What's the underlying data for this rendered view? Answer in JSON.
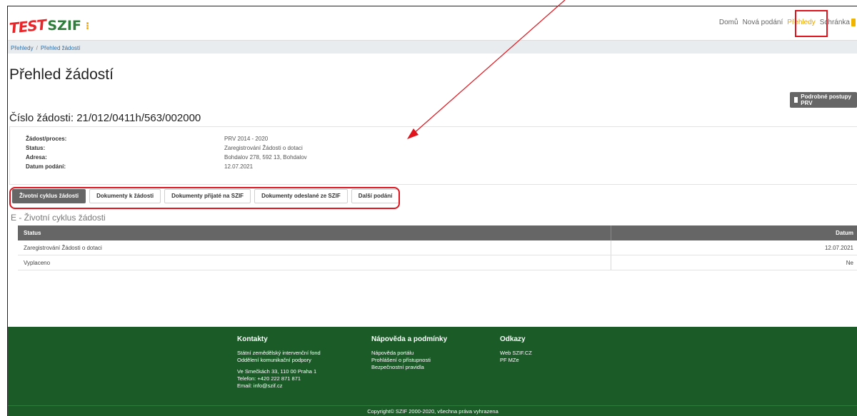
{
  "logo": {
    "test": "TEST",
    "szif": "SZIF"
  },
  "nav": {
    "items": [
      "Domů",
      "Nová podání",
      "Přehledy",
      "Schránka"
    ],
    "active_index": 2
  },
  "breadcrumb": [
    "Přehledy",
    "Přehled žádostí"
  ],
  "page_title": "Přehled žádostí",
  "procedures_button": "Podrobné postupy PRV",
  "application_number": "Číslo žádosti: 21/012/0411h/563/002000",
  "info": [
    {
      "label": "Žádost/proces:",
      "value": "PRV 2014 - 2020"
    },
    {
      "label": "Status:",
      "value": "Zaregistrování Žádosti o dotaci"
    },
    {
      "label": "Adresa:",
      "value": "Bohdalov 278, 592 13, Bohdalov"
    },
    {
      "label": "Datum podání:",
      "value": "12.07.2021"
    }
  ],
  "tabs": [
    "Životní cyklus žádosti",
    "Dokumenty k žádosti",
    "Dokumenty přijaté na SZIF",
    "Dokumenty odeslané ze SZIF",
    "Další podání"
  ],
  "active_tab_index": 0,
  "section_title": "E - Životní cyklus žádosti",
  "table": {
    "headers": {
      "status": "Status",
      "date": "Datum"
    },
    "rows": [
      {
        "status": "Zaregistrování Žádosti o dotaci",
        "date": "12.07.2021"
      },
      {
        "status": "Vyplaceno",
        "date": "Ne"
      }
    ]
  },
  "footer": {
    "contacts": {
      "title": "Kontakty",
      "lines1": [
        "Státní zemědělský intervenční fond",
        "Oddělení komunikační podpory"
      ],
      "lines2": [
        "Ve Smečkách 33, 110 00 Praha 1",
        "Telefon: +420 222 871 871",
        "Email: info@szif.cz"
      ]
    },
    "help": {
      "title": "Nápověda a podmínky",
      "lines": [
        "Nápověda portálu",
        "Prohlášení o přístupnosti",
        "Bezpečnostní pravidla"
      ]
    },
    "links": {
      "title": "Odkazy",
      "lines": [
        "Web SZIF.CZ",
        "PF MZe"
      ]
    },
    "copyright": "Copyright© SZIF 2000-2020, všechna práva vyhrazena"
  },
  "colors": {
    "brand_green": "#1a5b27",
    "accent_orange": "#e8a400",
    "annotation_red": "#e0141c",
    "tab_dark": "#666666"
  }
}
